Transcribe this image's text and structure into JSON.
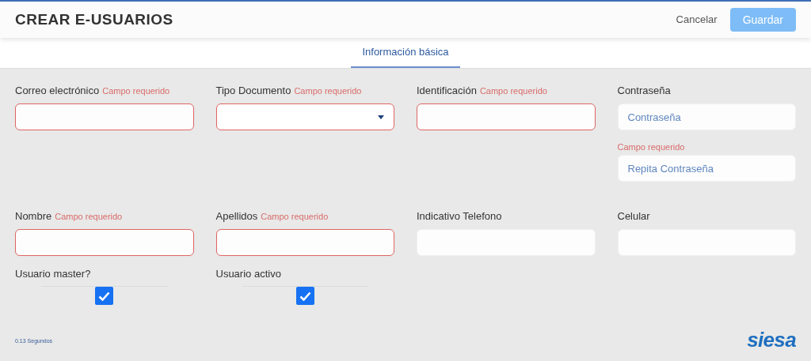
{
  "header": {
    "title": "CREAR E-USUARIOS",
    "actions": [
      {
        "label": "Cancelar",
        "kind": "link",
        "disabled": false
      },
      {
        "label": "Guardar",
        "kind": "primary",
        "disabled": true
      }
    ]
  },
  "tabs": [
    {
      "label": "Información básica",
      "selected": true
    }
  ],
  "rows": [
    [
      {
        "label": "Correo electrónico",
        "error": "Campo requerido",
        "kind": "text",
        "invalid": true
      },
      {
        "label": "Tipo Documento",
        "error": "Campo requerido",
        "kind": "select",
        "invalid": true
      },
      {
        "label": "Identificación",
        "error": "Campo requerido",
        "kind": "text",
        "invalid": true
      },
      {
        "label": "Contraseña",
        "kind": "password",
        "invalid": false,
        "placeholder": "Contraseña",
        "confirm": {
          "error": "Campo requerido",
          "placeholder": "Repita Contraseña"
        }
      }
    ],
    [
      {
        "label": "Nombre",
        "error": "Campo requerido",
        "kind": "text",
        "invalid": true
      },
      {
        "label": "Apellidos",
        "error": "Campo requerido",
        "kind": "text",
        "invalid": true
      },
      {
        "label": "Indicativo Telefono",
        "kind": "text",
        "invalid": false
      },
      {
        "label": "Celular",
        "kind": "text",
        "invalid": false
      }
    ]
  ],
  "checkboxes": [
    {
      "label": "Usuario master?",
      "checked": true
    },
    {
      "label": "Usuario activo",
      "checked": true
    }
  ],
  "footer": {
    "timing": "0.13 Segundos",
    "logo": "siesa"
  }
}
